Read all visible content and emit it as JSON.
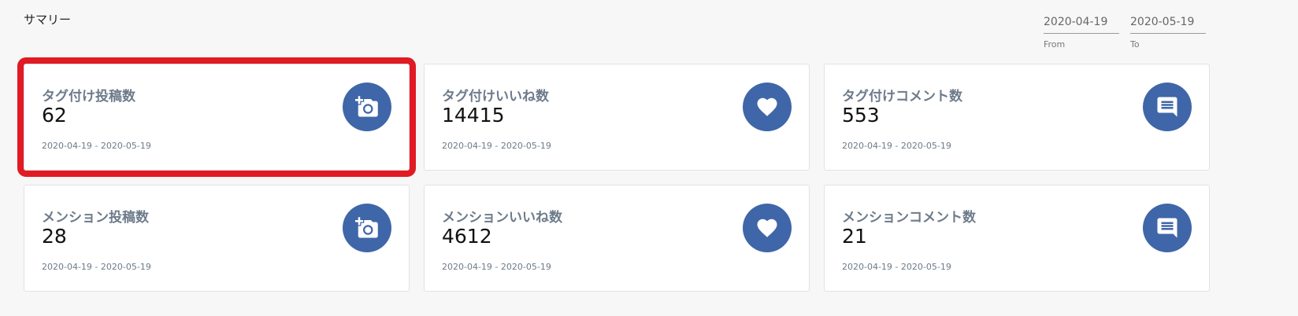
{
  "summary": {
    "title": "サマリー"
  },
  "date_range": {
    "from_value": "2020-04-19",
    "from_label": "From",
    "to_value": "2020-05-19",
    "to_label": "To"
  },
  "cards": [
    {
      "title": "タグ付け投稿数",
      "value": "62",
      "range": "2020-04-19 - 2020-05-19",
      "icon": "add-photo-icon"
    },
    {
      "title": "タグ付けいいね数",
      "value": "14415",
      "range": "2020-04-19 - 2020-05-19",
      "icon": "heart-icon"
    },
    {
      "title": "タグ付けコメント数",
      "value": "553",
      "range": "2020-04-19 - 2020-05-19",
      "icon": "comment-icon"
    },
    {
      "title": "メンション投稿数",
      "value": "28",
      "range": "2020-04-19 - 2020-05-19",
      "icon": "add-photo-icon"
    },
    {
      "title": "メンションいいね数",
      "value": "4612",
      "range": "2020-04-19 - 2020-05-19",
      "icon": "heart-icon"
    },
    {
      "title": "メンションコメント数",
      "value": "21",
      "range": "2020-04-19 - 2020-05-19",
      "icon": "comment-icon"
    }
  ],
  "colors": {
    "icon_background": "#3f66a8",
    "highlight_border": "#e01b24",
    "card_title": "#6d7b8a"
  }
}
